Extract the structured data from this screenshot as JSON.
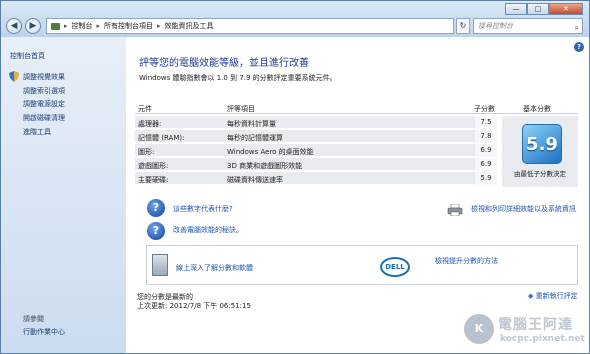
{
  "window": {
    "caption": {
      "minimize": "—",
      "maximize": "□",
      "close": "✕"
    }
  },
  "nav": {
    "back": "◀",
    "forward": "▶"
  },
  "breadcrumb": [
    "控制台",
    "所有控制台項目",
    "效能資訊及工具"
  ],
  "search": {
    "placeholder": "搜尋控制台"
  },
  "sidebar": {
    "home": "控制台首頁",
    "items": [
      "調整視覺效果",
      "調整索引選項",
      "調整電源設定",
      "開啟磁碟清理",
      "進階工具"
    ],
    "see_also_title": "請參閱",
    "see_also": [
      "行動作業中心"
    ]
  },
  "main": {
    "title": "評等您的電腦效能等級，並且進行改善",
    "subtitle": "Windows 體驗指數會以 1.0 到 7.9 的分數評定重要系統元件。",
    "table": {
      "headers": {
        "component": "元件",
        "item": "評等項目",
        "subscore": "子分數",
        "base": "基本分數"
      },
      "rows": [
        {
          "component": "處理器:",
          "item": "每秒資料計算量",
          "score": "7.5"
        },
        {
          "component": "記憶體 (RAM):",
          "item": "每秒的記憶體運算",
          "score": "7.8"
        },
        {
          "component": "圖形:",
          "item": "Windows Aero 的桌面效能",
          "score": "6.9"
        },
        {
          "component": "遊戲圖形:",
          "item": "3D 商業和遊戲圖形效能",
          "score": "6.9"
        },
        {
          "component": "主要硬碟:",
          "item": "磁碟資料傳送速率",
          "score": "5.9"
        }
      ],
      "base_score": "5.9",
      "base_caption": "由最低子分數決定"
    },
    "links": {
      "what_numbers": "這些數字代表什麼?",
      "improve": "改善電腦效能的秘訣。",
      "print": "檢視和列印詳細效能以及系統資訊"
    },
    "panel": {
      "learn_more": "線上深入了解分數和軟體",
      "dell_logo": "DELL",
      "how_improve": "檢視提升分數的方法"
    },
    "status": {
      "line1": "您的分數是最新的",
      "line2": "上次更新: 2012/7/8 下午 06:51:15",
      "rerun": "重新執行評定"
    }
  },
  "watermark": {
    "line1": "電腦王阿達",
    "line2": "kocpc.pixnet.net",
    "logo": "K"
  }
}
